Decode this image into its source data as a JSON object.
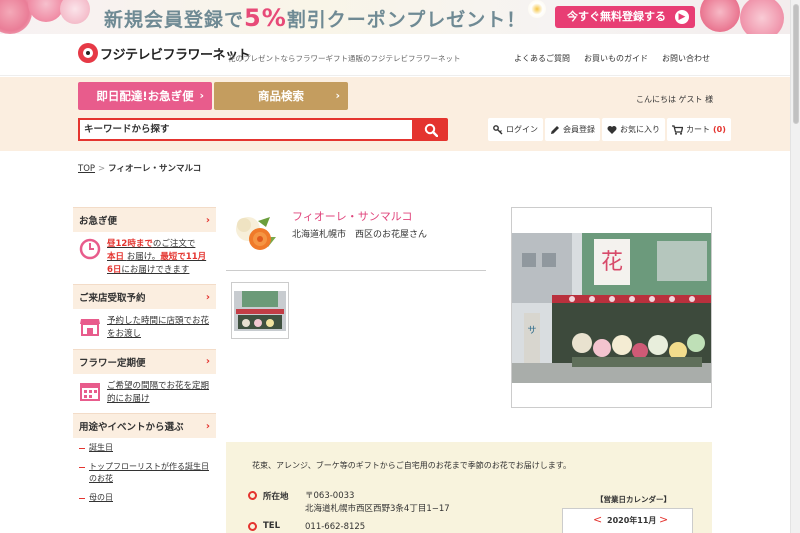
{
  "banner": {
    "text_a": "新規会員登録で",
    "percent": "5%",
    "text_b": "割引クーポンプレゼント！",
    "button": "今すぐ無料登録する"
  },
  "header": {
    "logo": "フジテレビフラワーネット",
    "tagline": "花のプレゼントならフラワーギフト通販のフジテレビフラワーネット",
    "links": [
      "よくあるご質問",
      "お買いものガイド",
      "お問い合わせ"
    ]
  },
  "nav": {
    "express": "即日配達!お急ぎ便",
    "product": "商品検索",
    "greeting": "こんにちは ゲスト 様",
    "search_placeholder": "キーワードから探す",
    "login": "ログイン",
    "register": "会員登録",
    "favorites": "お気に入り",
    "cart": "カート",
    "cart_count": "(0)"
  },
  "breadcrumb": {
    "top": "TOP",
    "sep": ">",
    "current": "フィオーレ・サンマルコ"
  },
  "sidebar": {
    "urgent": {
      "title": "お急ぎ便",
      "t1": "昼12時まで",
      "t2": "のご注文で",
      "t3": "本日",
      "t4": "お届け。",
      "t5": "最短で11月6日",
      "t6": "にお届けできます"
    },
    "pickup": {
      "title": "ご来店受取予約",
      "body": "予約した時間に店頭でお花をお渡し"
    },
    "regular": {
      "title": "フラワー定期便",
      "body": "ご希望の間隔でお花を定期的にお届け"
    },
    "occasion": {
      "title": "用途やイベントから選ぶ",
      "items": [
        "誕生日",
        "トップフローリストが作る誕生日のお花",
        "母の日"
      ]
    }
  },
  "shop": {
    "name": "フィオーレ・サンマルコ",
    "location": "北海道札幌市　西区のお花屋さん",
    "description": "花束、アレンジ、ブーケ等のギフトからご自宅用のお花まで季節のお花でお届けします。",
    "address_label": "所在地",
    "zip": "〒063-0033",
    "address": "北海道札幌市西区西野3条4丁目1−17",
    "tel_label": "TEL",
    "tel": "011-662-8125"
  },
  "calendar": {
    "title": "【営業日カレンダー】",
    "month": "2020年11月",
    "prev": "<",
    "next": ">"
  },
  "colors": {
    "accent_red": "#e4342f",
    "pink": "#e85c8c",
    "gold": "#c49d5f",
    "beige": "#fbeee0"
  }
}
